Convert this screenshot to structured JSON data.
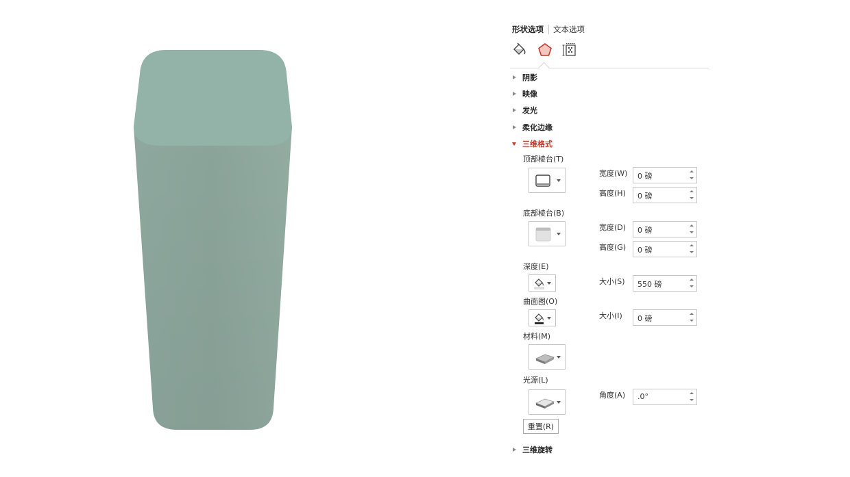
{
  "tabs": {
    "shape_options": "形状选项",
    "text_options": "文本选项"
  },
  "category_icons": [
    "fill-line-icon",
    "effects-pentagon-icon",
    "size-properties-icon"
  ],
  "colors": {
    "accent": "#c0392b",
    "shape_top": "#93b3a8",
    "shape_side": "#8da89e"
  },
  "sections": {
    "shadow": "阴影",
    "reflection": "映像",
    "glow": "发光",
    "soft_edges": "柔化边缘",
    "format_3d": "三维格式",
    "rotation_3d": "三维旋转"
  },
  "format_3d": {
    "top_bevel": {
      "label": "顶部棱台(T)",
      "width_label": "宽度(W)",
      "width_value": "0 磅",
      "height_label": "高度(H)",
      "height_value": "0 磅"
    },
    "bottom_bevel": {
      "label": "底部棱台(B)",
      "width_label": "宽度(D)",
      "width_value": "0 磅",
      "height_label": "高度(G)",
      "height_value": "0 磅"
    },
    "depth": {
      "label": "深度(E)",
      "size_label": "大小(S)",
      "size_value": "550 磅"
    },
    "contour": {
      "label": "曲面图(O)",
      "size_label": "大小(I)",
      "size_value": "0 磅"
    },
    "material": {
      "label": "材料(M)"
    },
    "lighting": {
      "label": "光源(L)",
      "angle_label": "角度(A)",
      "angle_value": ".0°"
    },
    "reset_label": "重置(R)"
  }
}
